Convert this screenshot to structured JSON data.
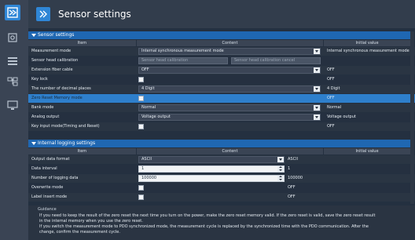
{
  "window": {
    "title": "Sensor settings",
    "accent": "#1f67b2",
    "highlight": "#2e7fcc"
  },
  "leftbar": {
    "items": [
      {
        "icon": "sensor-settings-icon"
      },
      {
        "icon": "sensor-head-icon"
      },
      {
        "icon": "list-icon"
      },
      {
        "icon": "hierarchy-icon"
      },
      {
        "icon": "monitor-icon"
      }
    ]
  },
  "sensor_settings": {
    "section_title": "Sensor settings",
    "headers": {
      "item": "Item",
      "content": "Content",
      "initial": "Initial value"
    },
    "rows": [
      {
        "item": "Measurement mode",
        "type": "dropdown",
        "value": "Internal synchronous measurement mode",
        "initial": "Internal synchronous measurement mode"
      },
      {
        "item": "Sensor head calibration",
        "type": "buttons",
        "buttons": [
          "Sensor head calibration",
          "Sensor head calibration cancel"
        ],
        "initial": ""
      },
      {
        "item": "Extension fiber cable",
        "type": "dropdown",
        "value": "OFF",
        "initial": "OFF"
      },
      {
        "item": "Key lock",
        "type": "checkbox",
        "initial": "OFF"
      },
      {
        "item": "The number of decimal places",
        "type": "dropdown",
        "value": "4 Digit",
        "initial": "4 Digit"
      },
      {
        "item": "Zero Reset Memory mode",
        "type": "checkbox",
        "initial": "OFF",
        "highlight": true
      },
      {
        "item": "Bank mode",
        "type": "dropdown",
        "value": "Normal",
        "initial": "Normal"
      },
      {
        "item": "Analog output",
        "type": "dropdown",
        "value": "Voltage output",
        "initial": "Voltage output"
      },
      {
        "item": "Key input mode(Timing and Reset)",
        "type": "checkbox",
        "initial": "OFF"
      }
    ]
  },
  "logging_settings": {
    "section_title": "Internal logging settings",
    "headers": {
      "item": "Item",
      "content": "Content",
      "initial": "Initial value"
    },
    "rows": [
      {
        "item": "Output data format",
        "type": "dropdown",
        "value": "ASCII",
        "initial": "ASCII"
      },
      {
        "item": "Data interval",
        "type": "spin",
        "value": "1",
        "initial": "1"
      },
      {
        "item": "Number of logging data",
        "type": "spin",
        "value": "100000",
        "initial": "100000"
      },
      {
        "item": "Overwrite mode",
        "type": "checkbox",
        "initial": "OFF"
      },
      {
        "item": "Label insert mode",
        "type": "checkbox",
        "initial": "OFF"
      }
    ]
  },
  "guidance": {
    "title": "Guidance",
    "lines": [
      "If you need to keep the result of the zero reset the next time you turn on the power, make the zero reset memory valid. If the zero reset is valid, save the zero reset result",
      "in the internal memory when you use the zero reset.",
      "If you switch the measurement mode to PDO synchronized mode, the measurement cycle is replaced by the synchronized time with the PDO communication. After the",
      "change, confirm the measurement cycle."
    ]
  }
}
